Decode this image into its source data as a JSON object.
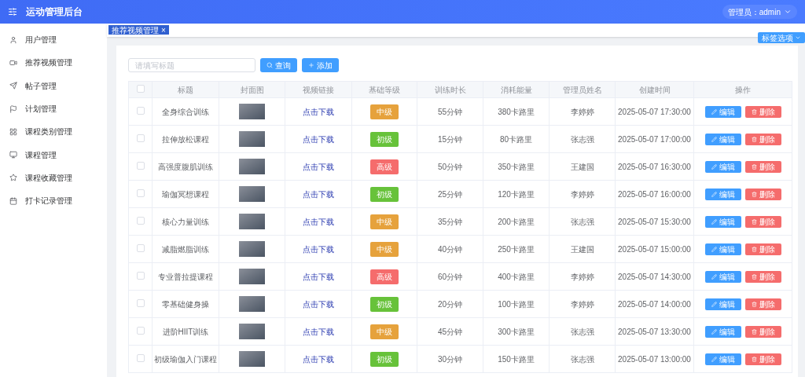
{
  "header": {
    "title": "运动管理后台",
    "user": "管理员：admin"
  },
  "sidebar": {
    "items": [
      {
        "label": "用户管理"
      },
      {
        "label": "推荐视频管理"
      },
      {
        "label": "帖子管理"
      },
      {
        "label": "计划管理"
      },
      {
        "label": "课程类别管理"
      },
      {
        "label": "课程管理"
      },
      {
        "label": "课程收藏管理"
      },
      {
        "label": "打卡记录管理"
      }
    ]
  },
  "tabs": [
    {
      "label": "推荐视频管理",
      "close": "×",
      "selected": true
    }
  ],
  "tab_options": "标签选项",
  "search": {
    "placeholder": "请填写标题",
    "search_button": "查询",
    "add_button": "添加"
  },
  "table": {
    "select_all": false,
    "columns": [
      "标题",
      "封面图",
      "视频链接",
      "基础等级",
      "训练时长",
      "消耗能量",
      "管理员姓名",
      "创建时间",
      "操作"
    ],
    "rows": [
      {
        "selected": false,
        "title": "全身综合训练",
        "link": "点击下载",
        "grade": {
          "label": "中级",
          "color": "#e6a23c"
        },
        "duration": "55分钟",
        "calories": "380卡路里",
        "admin": "李婷婷",
        "created": "2025-05-07 17:30:00",
        "edit": "编辑",
        "delete": "删除"
      },
      {
        "selected": false,
        "title": "拉伸放松课程",
        "link": "点击下载",
        "grade": {
          "label": "初级",
          "color": "#67c23a"
        },
        "duration": "15分钟",
        "calories": "80卡路里",
        "admin": "张志强",
        "created": "2025-05-07 17:00:00",
        "edit": "编辑",
        "delete": "删除"
      },
      {
        "selected": false,
        "title": "高强度腹肌训练",
        "link": "点击下载",
        "grade": {
          "label": "高级",
          "color": "#f56c6c"
        },
        "duration": "50分钟",
        "calories": "350卡路里",
        "admin": "王建国",
        "created": "2025-05-07 16:30:00",
        "edit": "编辑",
        "delete": "删除"
      },
      {
        "selected": false,
        "title": "瑜伽冥想课程",
        "link": "点击下载",
        "grade": {
          "label": "初级",
          "color": "#67c23a"
        },
        "duration": "25分钟",
        "calories": "120卡路里",
        "admin": "李婷婷",
        "created": "2025-05-07 16:00:00",
        "edit": "编辑",
        "delete": "删除"
      },
      {
        "selected": false,
        "title": "核心力量训练",
        "link": "点击下载",
        "grade": {
          "label": "中级",
          "color": "#e6a23c"
        },
        "duration": "35分钟",
        "calories": "200卡路里",
        "admin": "张志强",
        "created": "2025-05-07 15:30:00",
        "edit": "编辑",
        "delete": "删除"
      },
      {
        "selected": false,
        "title": "减脂燃脂训练",
        "link": "点击下载",
        "grade": {
          "label": "中级",
          "color": "#e6a23c"
        },
        "duration": "40分钟",
        "calories": "250卡路里",
        "admin": "王建国",
        "created": "2025-05-07 15:00:00",
        "edit": "编辑",
        "delete": "删除"
      },
      {
        "selected": false,
        "title": "专业普拉提课程",
        "link": "点击下载",
        "grade": {
          "label": "高级",
          "color": "#f56c6c"
        },
        "duration": "60分钟",
        "calories": "400卡路里",
        "admin": "李婷婷",
        "created": "2025-05-07 14:30:00",
        "edit": "编辑",
        "delete": "删除"
      },
      {
        "selected": false,
        "title": "零基础健身操",
        "link": "点击下载",
        "grade": {
          "label": "初级",
          "color": "#67c23a"
        },
        "duration": "20分钟",
        "calories": "100卡路里",
        "admin": "李婷婷",
        "created": "2025-05-07 14:00:00",
        "edit": "编辑",
        "delete": "删除"
      },
      {
        "selected": false,
        "title": "进阶HIIT训练",
        "link": "点击下载",
        "grade": {
          "label": "中级",
          "color": "#e6a23c"
        },
        "duration": "45分钟",
        "calories": "300卡路里",
        "admin": "张志强",
        "created": "2025-05-07 13:30:00",
        "edit": "编辑",
        "delete": "删除"
      },
      {
        "selected": false,
        "title": "初级瑜伽入门课程",
        "link": "点击下载",
        "grade": {
          "label": "初级",
          "color": "#67c23a"
        },
        "duration": "30分钟",
        "calories": "150卡路里",
        "admin": "张志强",
        "created": "2025-05-07 13:00:00",
        "edit": "编辑",
        "delete": "删除"
      }
    ]
  }
}
